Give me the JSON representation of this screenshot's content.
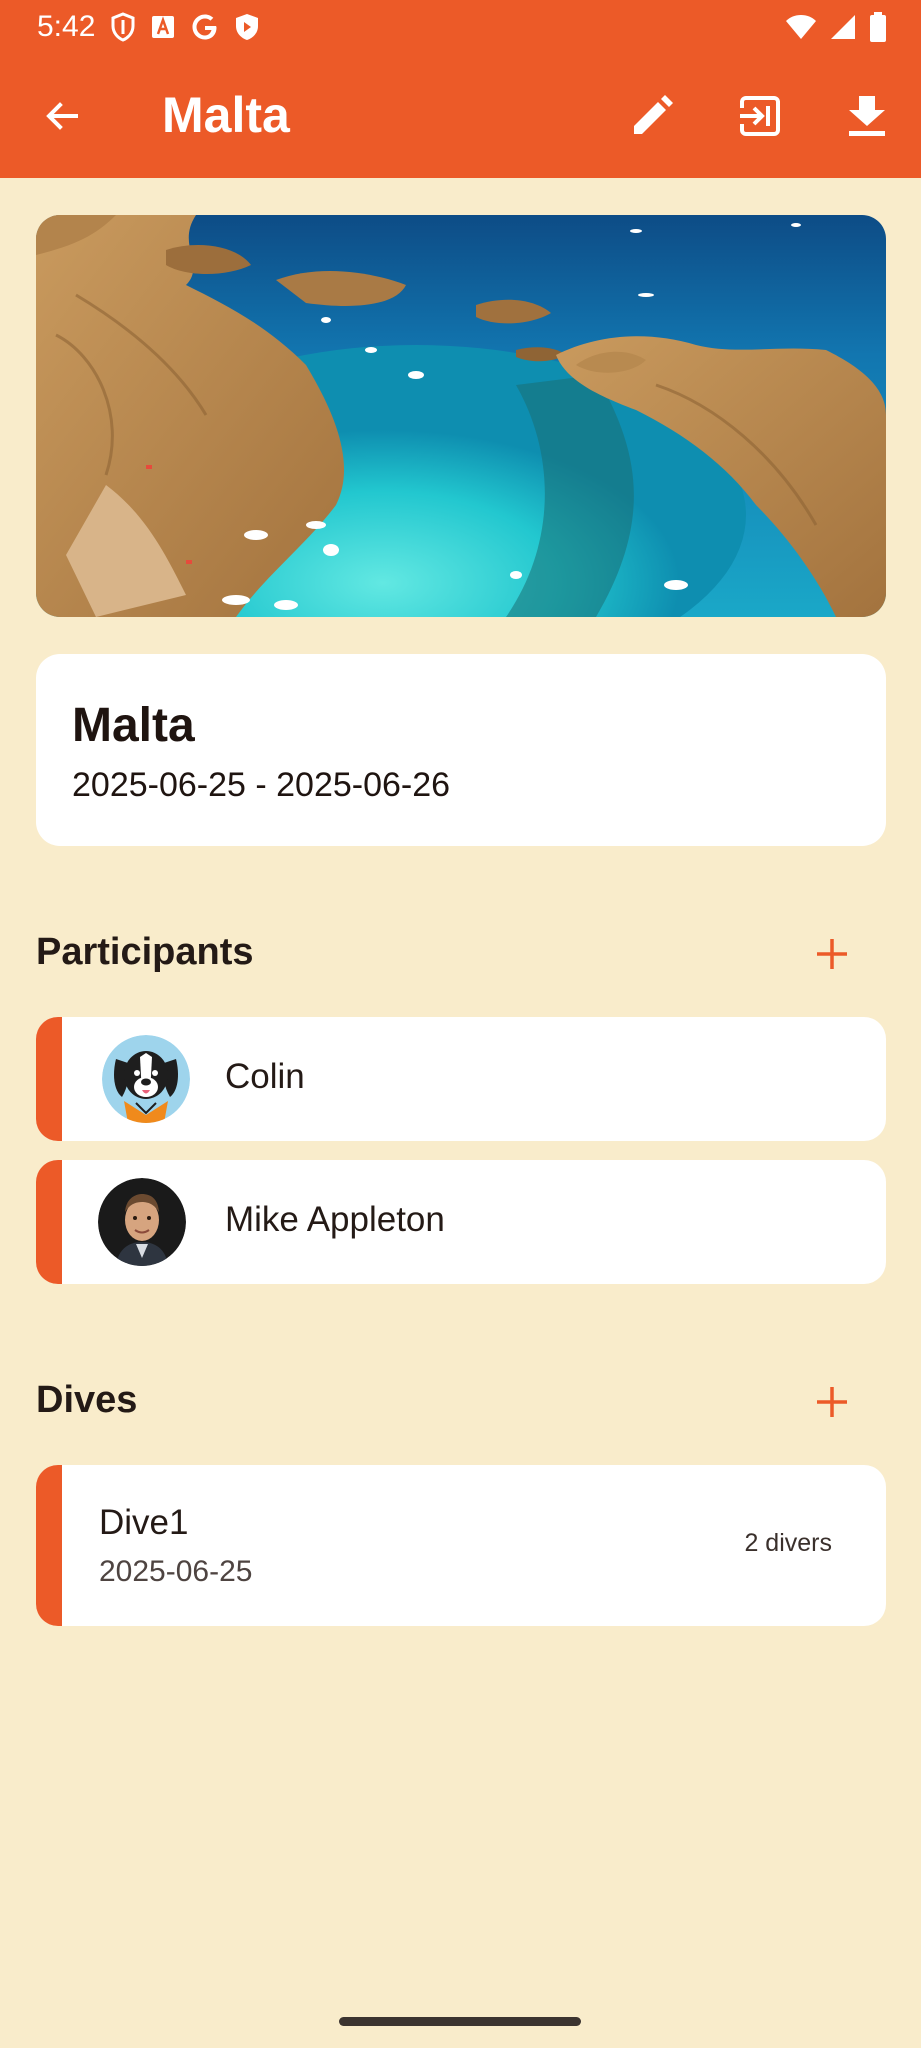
{
  "status_bar": {
    "time": "5:42",
    "left_icons": [
      "shield-icon",
      "font-a-icon",
      "google-g-icon",
      "play-shield-icon"
    ],
    "right_icons": [
      "wifi-icon",
      "signal-icon",
      "battery-icon"
    ]
  },
  "app_bar": {
    "title": "Malta",
    "back_icon": "arrow-left-icon",
    "actions": [
      "pencil-icon",
      "exit-icon",
      "download-icon"
    ],
    "color": "#EC5A28"
  },
  "trip": {
    "name": "Malta",
    "dates": "2025-06-25 - 2025-06-26"
  },
  "participants": {
    "title": "Participants",
    "add_icon": "plus-icon",
    "items": [
      {
        "name": "Colin",
        "avatar": "dog-avatar"
      },
      {
        "name": "Mike Appleton",
        "avatar": "person-avatar"
      }
    ]
  },
  "dives": {
    "title": "Dives",
    "add_icon": "plus-icon",
    "items": [
      {
        "title": "Dive1",
        "date": "2025-06-25",
        "divers": "2 divers"
      }
    ]
  },
  "colors": {
    "accent": "#EC5A28",
    "background": "#F9ECCB",
    "card": "#FFFFFF"
  }
}
